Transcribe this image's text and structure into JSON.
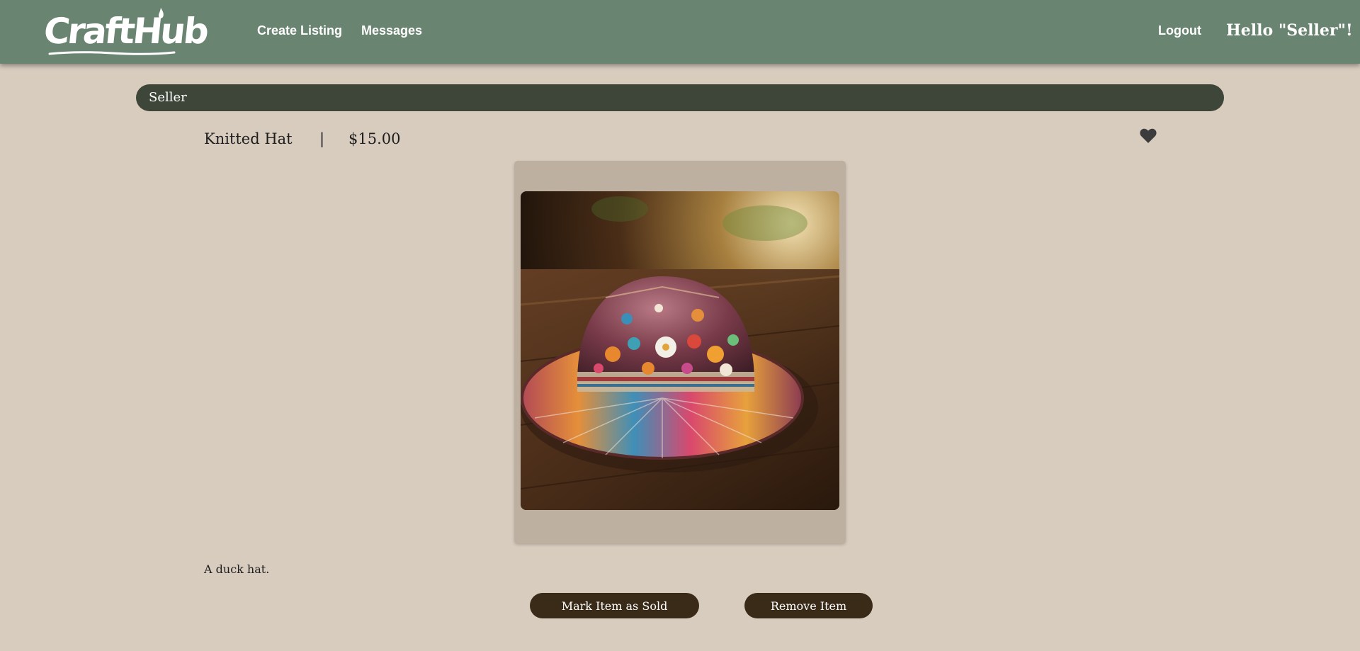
{
  "header": {
    "logo_text": "CraftHub",
    "nav": {
      "create_listing": "Create Listing",
      "messages": "Messages",
      "logout": "Logout"
    },
    "greeting": "Hello \"Seller\"!"
  },
  "seller_bar": {
    "name": "Seller"
  },
  "listing": {
    "title": "Knitted Hat",
    "separator": "|",
    "price": "$15.00",
    "favorite_icon": "heart-icon",
    "image_alt": "Colorful embroidered hat on a wooden table",
    "description": "A duck hat.",
    "actions": {
      "mark_sold": "Mark Item as Sold",
      "remove": "Remove Item"
    }
  },
  "colors": {
    "page_background": "#d8ccbf",
    "navbar": "#6a8472",
    "seller_bar": "#3e4639",
    "image_card": "#bdb0a1",
    "buttons": "#3a2b19"
  }
}
